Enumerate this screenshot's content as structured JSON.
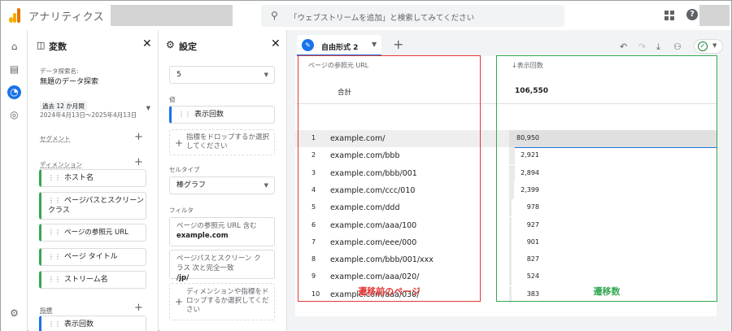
{
  "header": {
    "app_title": "アナリティクス",
    "search_placeholder": "「ウェブストリームを追加」と検索してみてください",
    "help_glyph": "?"
  },
  "variables_panel": {
    "title": "変数",
    "exploration_name_label": "データ探索名:",
    "exploration_name": "無題のデータ探索",
    "date_range_label": "過去 12 か月間",
    "date_range": "2024年4月13日～2025年4月13日",
    "segments_label": "セグメント",
    "dimensions_label": "ディメンション",
    "dimensions": [
      "ホスト名",
      "ページパスとスクリーン クラス",
      "ページの参照元 URL",
      "ページ タイトル",
      "ストリーム名"
    ],
    "metrics_label": "指標",
    "metrics": [
      "表示回数"
    ]
  },
  "settings_panel": {
    "title": "設定",
    "rows_value": "5",
    "values_label": "値",
    "value_chip": "表示回数",
    "drop_metric_text": "指標をドロップするか選択してください",
    "cell_type_label": "セルタイプ",
    "cell_type_value": "棒グラフ",
    "filters_label": "フィルタ",
    "filter1_text": "ページの参照元 URL 含む",
    "filter1_value": "example.com",
    "filter2_text": "ページパスとスクリーン クラス 次と完全一致",
    "filter2_value": "/jp/",
    "drop_dim_text": "ディメンションや指標をドロップするか選択してください"
  },
  "canvas": {
    "tab_label": "自由形式 2",
    "col_dimension": "ページの参照元 URL",
    "col_metric": "↓表示回数",
    "total_label": "合計",
    "total_value": "106,550",
    "rows": [
      {
        "idx": "1",
        "url": "example.com/",
        "value": "80,950",
        "num": 80950
      },
      {
        "idx": "2",
        "url": "example.com/bbb",
        "value": "2,921",
        "num": 2921
      },
      {
        "idx": "3",
        "url": "example.com/bbb/001",
        "value": "2,894",
        "num": 2894
      },
      {
        "idx": "4",
        "url": "example.com/ccc/010",
        "value": "2,399",
        "num": 2399
      },
      {
        "idx": "5",
        "url": "example.com/ddd",
        "value": "978",
        "num": 978
      },
      {
        "idx": "6",
        "url": "example.com/aaa/100",
        "value": "927",
        "num": 927
      },
      {
        "idx": "7",
        "url": "example.com/eee/000",
        "value": "901",
        "num": 901
      },
      {
        "idx": "8",
        "url": "example.com/bbb/001/xxx",
        "value": "827",
        "num": 827
      },
      {
        "idx": "9",
        "url": "example.com/aaa/020/",
        "value": "524",
        "num": 524
      },
      {
        "idx": "10",
        "url": "example.com/aaa/030/",
        "value": "383",
        "num": 383
      }
    ]
  },
  "annotations": {
    "red_caption": "遷移前のページ",
    "green_caption": "遷移数",
    "red_color": "#e53935",
    "green_color": "#34a853"
  },
  "colors": {
    "accent": "#1a73e8"
  }
}
